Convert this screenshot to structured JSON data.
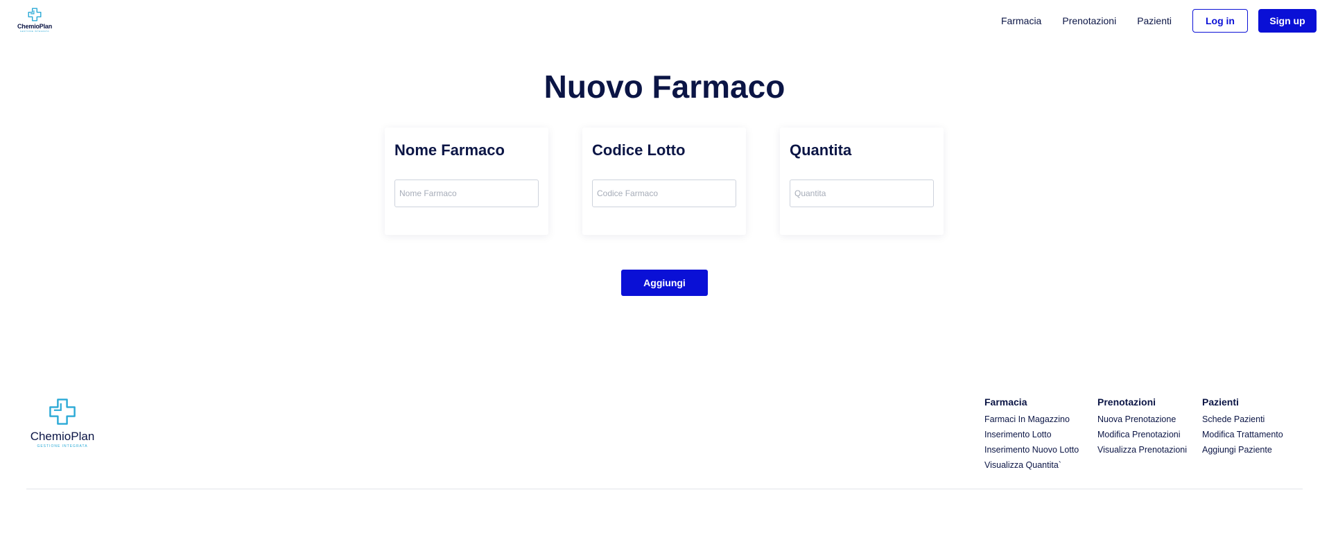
{
  "header": {
    "logo": {
      "brand": "ChemioPlan",
      "tagline": "GESTIONE INTEGRATA",
      "icon": "medical-cross-icon"
    },
    "nav": [
      "Farmacia",
      "Prenotazioni",
      "Pazienti"
    ],
    "login_label": "Log in",
    "signup_label": "Sign up"
  },
  "main": {
    "title": "Nuovo Farmaco",
    "cards": [
      {
        "title": "Nome Farmaco",
        "placeholder": "Nome Farmaco"
      },
      {
        "title": "Codice Lotto",
        "placeholder": "Codice Farmaco"
      },
      {
        "title": "Quantita",
        "placeholder": "Quantita"
      }
    ],
    "submit_label": "Aggiungi"
  },
  "footer": {
    "logo": {
      "brand": "ChemioPlan",
      "tagline": "GESTIONE INTEGRATA",
      "icon": "medical-cross-icon"
    },
    "columns": [
      {
        "title": "Farmacia",
        "links": [
          "Farmaci In Magazzino",
          "Inserimento Lotto",
          "Inserimento Nuovo Lotto",
          "Visualizza Quantita`"
        ]
      },
      {
        "title": "Prenotazioni",
        "links": [
          "Nuova Prenotazione",
          "Modifica Prenotazioni",
          "Visualizza Prenotazioni"
        ]
      },
      {
        "title": "Pazienti",
        "links": [
          "Schede Pazienti",
          "Modifica Trattamento",
          "Aggiungi Paziente"
        ]
      }
    ]
  },
  "colors": {
    "primary": "#0a10d6",
    "text_dark": "#0b1545",
    "logo_accent": "#2aa9d6"
  }
}
